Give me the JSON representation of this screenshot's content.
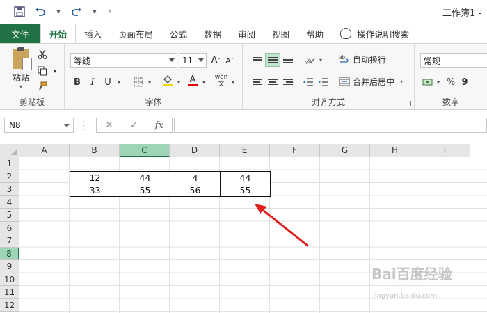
{
  "window": {
    "title": "工作簿1 -"
  },
  "quick_access": {
    "save_icon": "save-icon",
    "undo_icon": "undo-icon",
    "redo_icon": "redo-icon",
    "customize_icon": "customize-icon"
  },
  "tabs": [
    {
      "label": "文件",
      "kind": "file"
    },
    {
      "label": "开始",
      "kind": "active"
    },
    {
      "label": "插入"
    },
    {
      "label": "页面布局"
    },
    {
      "label": "公式"
    },
    {
      "label": "数据"
    },
    {
      "label": "审阅"
    },
    {
      "label": "视图"
    },
    {
      "label": "帮助"
    },
    {
      "label": "操作说明搜索",
      "kind": "search"
    }
  ],
  "ribbon": {
    "clipboard": {
      "paste_label": "粘贴",
      "group_label": "剪贴板"
    },
    "font": {
      "font_name": "等线",
      "font_size": "11",
      "bold": "B",
      "italic": "I",
      "underline": "U",
      "grow": "A",
      "shrink": "A",
      "font_color_letter": "A",
      "phonetic": "wén",
      "group_label": "字体"
    },
    "alignment": {
      "wrap_text": "自动换行",
      "merge_center": "合并后居中",
      "group_label": "对齐方式"
    },
    "number": {
      "format": "常规",
      "percent": "%",
      "comma": "9",
      "group_label": "数字"
    }
  },
  "formula_bar": {
    "name_box": "N8",
    "fx_label": "fx",
    "formula": ""
  },
  "grid": {
    "columns": [
      "A",
      "B",
      "C",
      "D",
      "E",
      "F",
      "G",
      "H",
      "I"
    ],
    "selected_column": "C",
    "rows": [
      "1",
      "2",
      "3",
      "4",
      "5",
      "6",
      "7",
      "8",
      "9",
      "10",
      "11",
      "12"
    ],
    "selected_row": "8",
    "data": {
      "B2": "12",
      "C2": "44",
      "D2": "4",
      "E2": "44",
      "B3": "33",
      "C3": "55",
      "D3": "56",
      "E3": "55"
    }
  },
  "annotation": {
    "arrow_color": "#e02020"
  },
  "watermark": {
    "text": "Bai百度经验",
    "subtext": "jingyan.baidu.com"
  },
  "colors": {
    "excel_green": "#217346",
    "header_selected": "#9fd5b7"
  }
}
